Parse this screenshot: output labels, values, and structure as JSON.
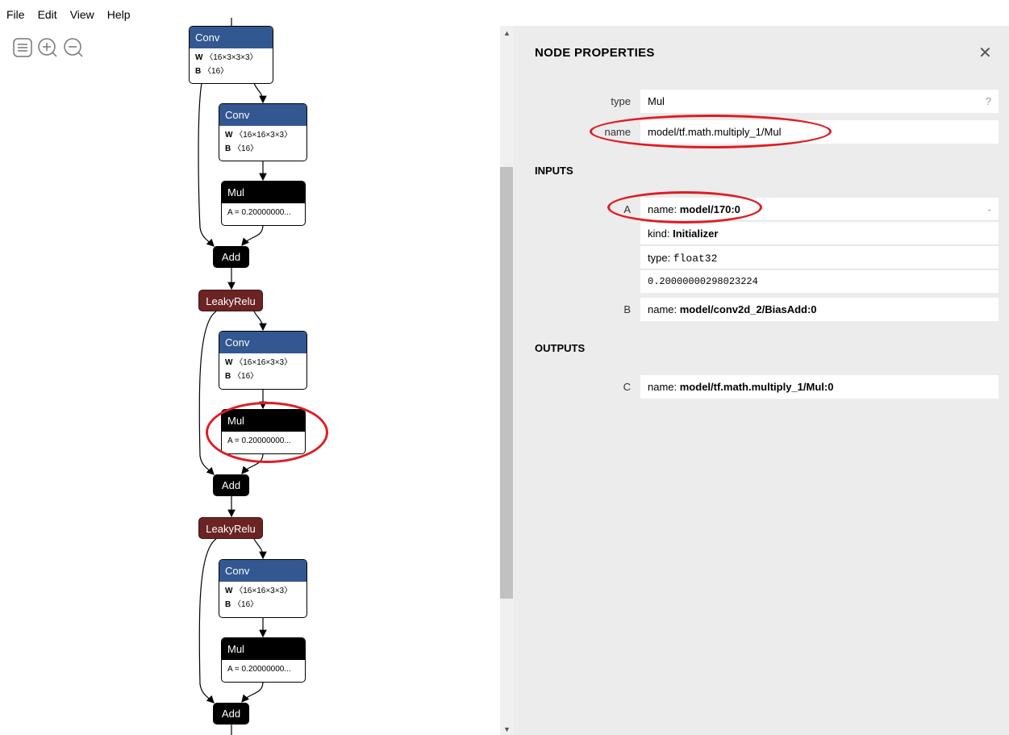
{
  "menu": [
    "File",
    "Edit",
    "View",
    "Help"
  ],
  "toolbar": {
    "icons": [
      "sidebar-icon",
      "zoom-in-icon",
      "zoom-out-icon"
    ]
  },
  "graph": {
    "conv_label": "Conv",
    "mul_label": "Mul",
    "add_label": "Add",
    "relu_label": "LeakyRelu",
    "conv1": {
      "w_key": "W",
      "w_val": "〈16×3×3×3〉",
      "b_key": "B",
      "b_val": "〈16〉"
    },
    "conv2": {
      "w_key": "W",
      "w_val": "〈16×16×3×3〉",
      "b_key": "B",
      "b_val": "〈16〉"
    },
    "mul_attr": "A = 0.20000000...",
    "colors": {
      "conv": "#335791",
      "mul": "#000000",
      "add": "#000000",
      "relu": "#6b2323"
    }
  },
  "panel": {
    "title": "NODE PROPERTIES",
    "close_icon": "close-icon",
    "type_label": "type",
    "type_value": "Mul",
    "type_help": "?",
    "name_label": "name",
    "name_value": "model/tf.math.multiply_1/Mul",
    "inputs_title": "INPUTS",
    "input_a": {
      "label": "A",
      "name_key": "name: ",
      "name_val": "model/170:0",
      "toggle": "-",
      "kind_key": "kind: ",
      "kind_val": "Initializer",
      "type_key": "type: ",
      "type_val": "float32",
      "value": "0.20000000298023224"
    },
    "input_b": {
      "label": "B",
      "name_key": "name: ",
      "name_val": "model/conv2d_2/BiasAdd:0"
    },
    "outputs_title": "OUTPUTS",
    "output_c": {
      "label": "C",
      "name_key": "name: ",
      "name_val": "model/tf.math.multiply_1/Mul:0"
    }
  },
  "annotation_color": "#e01b24"
}
